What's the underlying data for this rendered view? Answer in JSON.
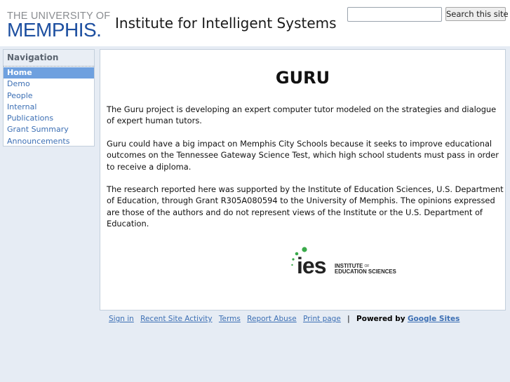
{
  "header": {
    "logo_line1": "THE UNIVERSITY OF",
    "logo_line2": "MEMPHIS.",
    "site_title": "Institute for Intelligent Systems",
    "search_placeholder": "",
    "search_button": "Search this site"
  },
  "nav": {
    "title": "Navigation",
    "items": [
      "Home",
      "Demo",
      "People",
      "Internal",
      "Publications",
      "Grant Summary",
      "Announcements"
    ],
    "active_index": 0
  },
  "main": {
    "title": "GURU",
    "paragraphs": [
      "The Guru project is developing an expert computer tutor modeled on the strategies and dialogue of expert human tutors.",
      "Guru could have a big impact on Memphis City Schools because it seeks to improve educational outcomes on the Tennessee Gateway Science Test, which high school students must pass in order to receive a diploma.",
      "The research reported here was supported by the Institute of Education Sciences, U.S. Department of Education, through Grant R305A080594 to the University of Memphis. The opinions expressed are those of the authors and do not represent views of the Institute or the U.S. Department of Education."
    ],
    "ies_logo": {
      "wordmark": "ies",
      "line1": "INSTITUTE",
      "line1_sub": "OF",
      "line2": "EDUCATION SCIENCES"
    }
  },
  "footer": {
    "links": [
      "Sign in",
      "Recent Site Activity",
      "Terms",
      "Report Abuse",
      "Print page"
    ],
    "separator": "|",
    "powered_by": "Powered by",
    "powered_link": "Google Sites"
  },
  "colors": {
    "page_background": "#e6ecf4",
    "link": "#3c6fb4",
    "nav_active": "#6ea0df",
    "memphis_blue": "#1d4fa0",
    "ies_green": "#3aaa4a"
  }
}
